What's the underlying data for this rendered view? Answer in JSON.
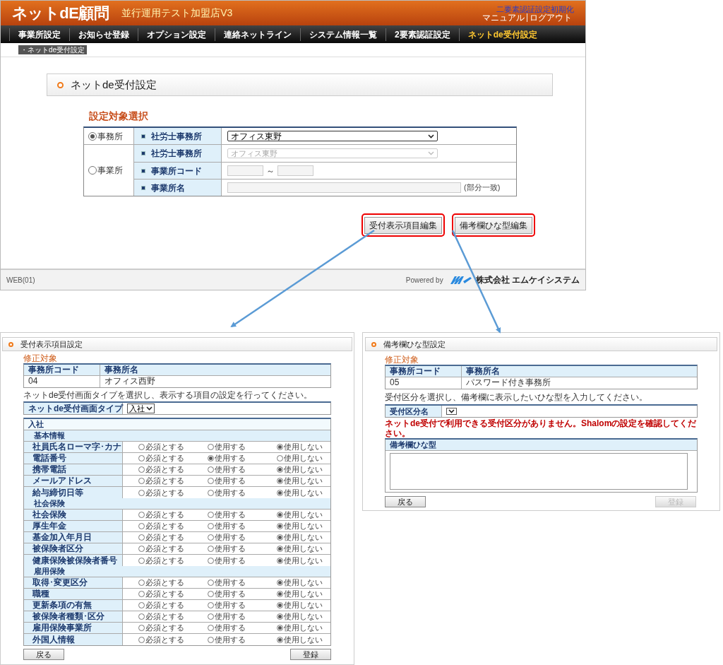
{
  "header": {
    "logo": "ネットdE顧問",
    "store_name": "並行運用テスト加盟店V3",
    "reset_link": "二要素認証設定初期化",
    "user_links": [
      "マニュアル",
      "ログアウト"
    ]
  },
  "nav": [
    {
      "label": "事業所設定",
      "selected": false
    },
    {
      "label": "お知らせ登録",
      "selected": false
    },
    {
      "label": "オプション設定",
      "selected": false
    },
    {
      "label": "連絡ネットライン",
      "selected": false
    },
    {
      "label": "システム情報一覧",
      "selected": false
    },
    {
      "label": "2要素認証設定",
      "selected": false
    },
    {
      "label": "ネットde受付設定",
      "selected": true
    }
  ],
  "breadcrumb": "・ネットde受付設定",
  "page_title": "ネットde受付設定",
  "target_section": {
    "title": "設定対象選択",
    "office": {
      "label": "事務所",
      "selected": true,
      "field_label": "社労士事務所",
      "value": "オフィス東野"
    },
    "establishment": {
      "label": "事業所",
      "selected": false,
      "fields": [
        {
          "kind": "select",
          "label": "社労士事務所",
          "value": "オフィス東野"
        },
        {
          "kind": "range",
          "label": "事業所コード",
          "separator": "～"
        },
        {
          "kind": "text",
          "label": "事業所名",
          "suffix": "(部分一致)"
        }
      ]
    }
  },
  "actions": [
    {
      "label": "受付表示項目編集",
      "highlighted": true
    },
    {
      "label": "備考欄ひな型編集",
      "highlighted": true
    }
  ],
  "footer": {
    "version": "WEB(01)",
    "powered_by": "Powered by",
    "company": "株式会社 エムケイシステム"
  },
  "display_panel": {
    "title": "受付表示項目設定",
    "target_title": "修正対象",
    "columns": [
      "事務所コード",
      "事務所名"
    ],
    "row": [
      "04",
      "オフィス西野"
    ],
    "note": "ネットde受付画面タイプを選択し、表示する項目の設定を行ってください。",
    "type_label": "ネットde受付画面タイプ",
    "type_value": "入社",
    "group": "入社",
    "sections": [
      {
        "title": "基本情報",
        "rows": [
          {
            "label": "社員氏名ローマ字･カナ",
            "options": [
              {
                "label": "必須とする",
                "selected": false
              },
              {
                "label": "使用する",
                "selected": false
              },
              {
                "label": "使用しない",
                "selected": true
              }
            ]
          },
          {
            "label": "電話番号",
            "options": [
              {
                "label": "必須とする",
                "selected": false
              },
              {
                "label": "使用する",
                "selected": true
              },
              {
                "label": "使用しない",
                "selected": false
              }
            ]
          },
          {
            "label": "携帯電話",
            "options": [
              {
                "label": "必須とする",
                "selected": false
              },
              {
                "label": "使用する",
                "selected": false
              },
              {
                "label": "使用しない",
                "selected": true
              }
            ]
          },
          {
            "label": "メールアドレス",
            "options": [
              {
                "label": "必須とする",
                "selected": false
              },
              {
                "label": "使用する",
                "selected": false
              },
              {
                "label": "使用しない",
                "selected": true
              }
            ]
          },
          {
            "label": "給与締切日等",
            "options": [
              {
                "label": "必須とする",
                "selected": false
              },
              {
                "label": "使用する",
                "selected": false
              },
              {
                "label": "使用しない",
                "selected": true
              }
            ]
          }
        ]
      },
      {
        "title": "社会保険",
        "rows": [
          {
            "label": "社会保険",
            "options": [
              {
                "label": "必須とする",
                "selected": false
              },
              {
                "label": "使用する",
                "selected": false
              },
              {
                "label": "使用しない",
                "selected": true
              }
            ]
          },
          {
            "label": "厚生年金",
            "options": [
              {
                "label": "必須とする",
                "selected": false
              },
              {
                "label": "使用する",
                "selected": false
              },
              {
                "label": "使用しない",
                "selected": true
              }
            ]
          },
          {
            "label": "基金加入年月日",
            "options": [
              {
                "label": "必須とする",
                "selected": false
              },
              {
                "label": "使用する",
                "selected": false
              },
              {
                "label": "使用しない",
                "selected": true
              }
            ]
          },
          {
            "label": "被保険者区分",
            "options": [
              {
                "label": "必須とする",
                "selected": false
              },
              {
                "label": "使用する",
                "selected": false
              },
              {
                "label": "使用しない",
                "selected": true
              }
            ]
          },
          {
            "label": "健康保険被保険者番号",
            "options": [
              {
                "label": "必須とする",
                "selected": false
              },
              {
                "label": "使用する",
                "selected": false
              },
              {
                "label": "使用しない",
                "selected": true
              }
            ]
          }
        ]
      },
      {
        "title": "雇用保険",
        "rows": [
          {
            "label": "取得･変更区分",
            "options": [
              {
                "label": "必須とする",
                "selected": false
              },
              {
                "label": "使用する",
                "selected": false
              },
              {
                "label": "使用しない",
                "selected": true
              }
            ]
          },
          {
            "label": "職種",
            "options": [
              {
                "label": "必須とする",
                "selected": false
              },
              {
                "label": "使用する",
                "selected": false
              },
              {
                "label": "使用しない",
                "selected": true
              }
            ]
          },
          {
            "label": "更新条項の有無",
            "options": [
              {
                "label": "必須とする",
                "selected": false
              },
              {
                "label": "使用する",
                "selected": false
              },
              {
                "label": "使用しない",
                "selected": true
              }
            ]
          },
          {
            "label": "被保険者種類･区分",
            "options": [
              {
                "label": "必須とする",
                "selected": false
              },
              {
                "label": "使用する",
                "selected": false
              },
              {
                "label": "使用しない",
                "selected": true
              }
            ]
          },
          {
            "label": "雇用保険事業所",
            "options": [
              {
                "label": "必須とする",
                "selected": false
              },
              {
                "label": "使用する",
                "selected": false
              },
              {
                "label": "使用しない",
                "selected": true
              }
            ]
          },
          {
            "label": "外国人情報",
            "options": [
              {
                "label": "必須とする",
                "selected": false
              },
              {
                "label": "使用する",
                "selected": false
              },
              {
                "label": "使用しない",
                "selected": true
              }
            ]
          }
        ]
      }
    ],
    "buttons": [
      {
        "label": "戻る",
        "disabled": false
      },
      {
        "label": "登録",
        "disabled": false
      }
    ]
  },
  "template_panel": {
    "title": "備考欄ひな型設定",
    "target_title": "修正対象",
    "columns": [
      "事務所コード",
      "事務所名"
    ],
    "row": [
      "05",
      "パスワード付き事務所"
    ],
    "note": "受付区分を選択し、備考欄に表示したいひな型を入力してください。",
    "category_label": "受付区分名",
    "error": "ネットde受付で利用できる受付区分がありません。Shalomの設定を確認してください。",
    "template_label": "備考欄ひな型",
    "buttons": [
      {
        "label": "戻る",
        "disabled": false
      },
      {
        "label": "登録",
        "disabled": true
      }
    ]
  }
}
